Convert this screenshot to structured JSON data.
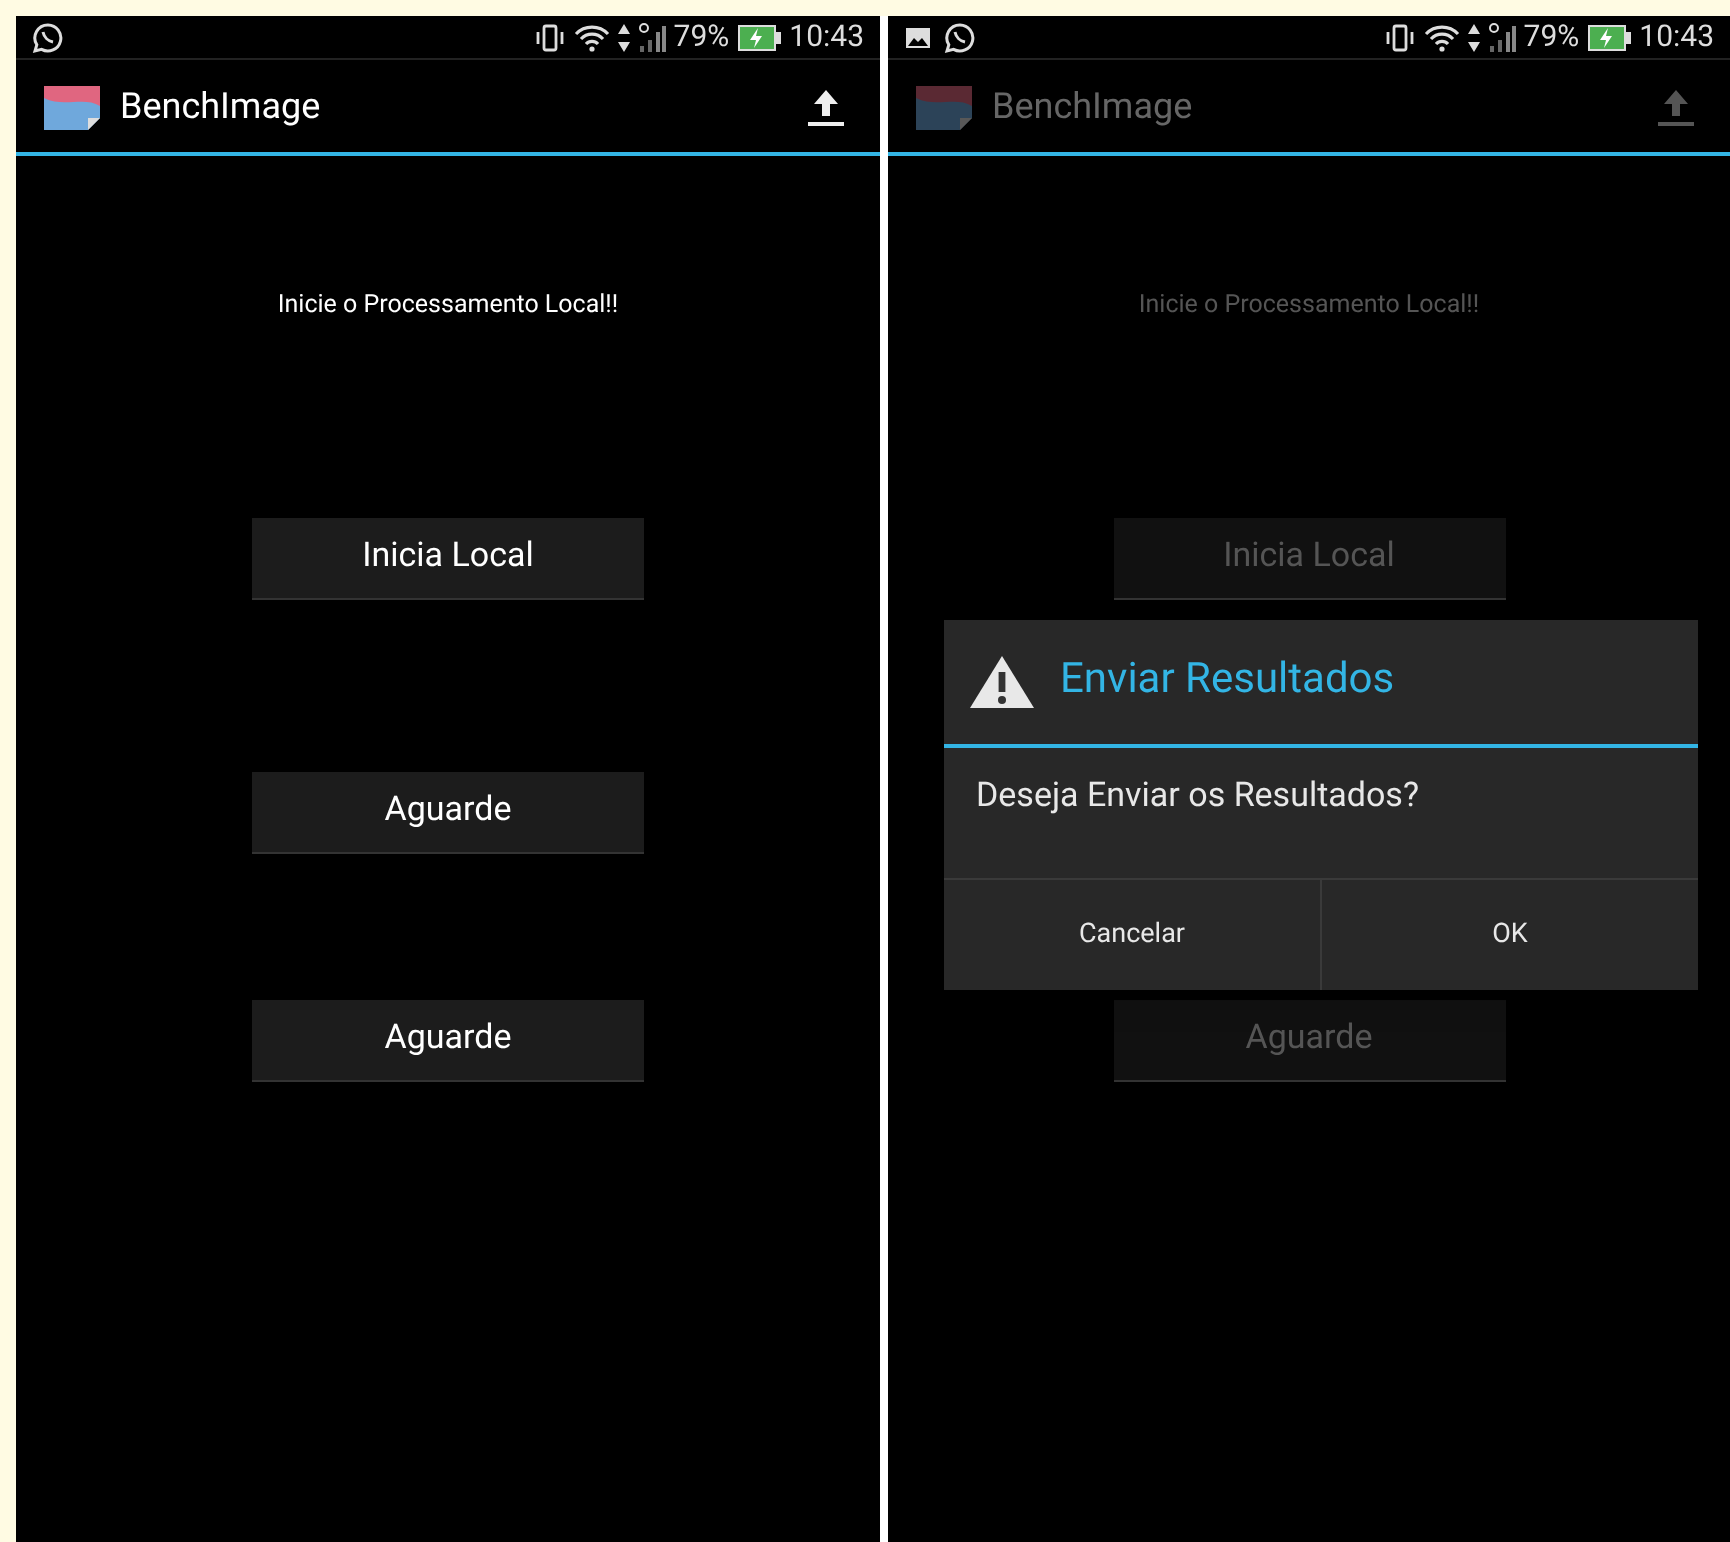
{
  "screens": [
    {
      "dimmed": false,
      "status_bar": {
        "notifications": [
          {
            "kind": "chat"
          }
        ],
        "battery": "79%",
        "time": "10:43"
      },
      "app_bar": {
        "title": "BenchImage"
      },
      "message": "Inicie o Processamento Local!!",
      "buttons": [
        {
          "kind": "button",
          "label": "Inicia Local"
        },
        {
          "kind": "button",
          "label": "Aguarde"
        },
        {
          "kind": "button",
          "label": "Aguarde"
        }
      ]
    },
    {
      "dimmed": true,
      "status_bar": {
        "notifications": [
          {
            "kind": "image"
          },
          {
            "kind": "chat"
          }
        ],
        "battery": "79%",
        "time": "10:43"
      },
      "app_bar": {
        "title": "BenchImage"
      },
      "message": "Inicie o Processamento Local!!",
      "buttons": [
        {
          "kind": "button",
          "label": "Inicia Local"
        },
        {
          "kind": "covered"
        },
        {
          "kind": "button",
          "label": "Aguarde"
        }
      ],
      "dialog": {
        "title": "Enviar Resultados",
        "message": "Deseja Enviar os Resultados?",
        "buttons": [
          "Cancelar",
          "OK"
        ]
      }
    }
  ]
}
